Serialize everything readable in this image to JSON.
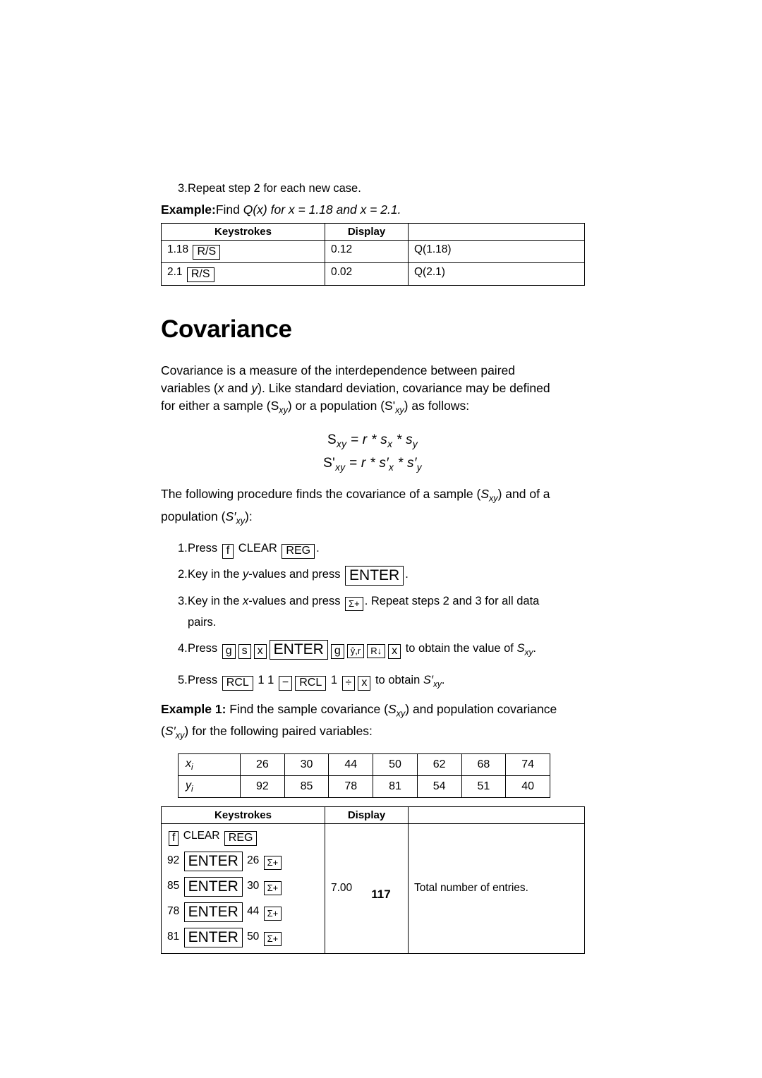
{
  "top_step": {
    "num": "3.",
    "text": "Repeat step 2 for each new case."
  },
  "example_q": {
    "label": "Example:",
    "text_1": "Find ",
    "q": "Q",
    "x1": "(x) for x = 1.18 and x = 2.1."
  },
  "table_q": {
    "headers": [
      "Keystrokes",
      "Display",
      ""
    ],
    "rows": [
      {
        "entry": "1.18",
        "key": "R/S",
        "display": "0.12",
        "note": "Q(1.18)"
      },
      {
        "entry": "2.1",
        "key": "R/S",
        "display": "0.02",
        "note": "Q(2.1)"
      }
    ]
  },
  "heading": "Covariance",
  "intro": {
    "l1": "Covariance is a measure of the interdependence between paired",
    "l2_a": "variables (",
    "l2_x": "x",
    "l2_b": " and ",
    "l2_y": "y",
    "l2_c": "). Like standard deviation, covariance may be defined",
    "l3_a": "for either a sample (S",
    "l3_sub1": "xy",
    "l3_b": ") or a population (S'",
    "l3_sub2": "xy",
    "l3_c": ") as follows:"
  },
  "formulas": {
    "f1": "S",
    "f1_sub": "xy",
    "f1_rest": " = r * s",
    "f1_sub2": "x",
    "f1_rest2": " * s",
    "f1_sub3": "y",
    "f2": "S'",
    "f2_sub": "xy",
    "f2_rest": " = r * s′",
    "f2_sub2": "x",
    "f2_rest2": " * s′",
    "f2_sub3": "y"
  },
  "procedure_intro": {
    "l1_a": "The following procedure finds the covariance of a sample (",
    "l1_s": "S",
    "l1_sub": "xy",
    "l1_b": ") and of a",
    "l2_a": "population (",
    "l2_s": "S′",
    "l2_sub": "xy",
    "l2_b": "):"
  },
  "steps": [
    {
      "num": "1.",
      "parts": [
        "Press ",
        "f",
        " CLEAR ",
        "REG",
        "."
      ]
    },
    {
      "num": "2.",
      "parts": [
        "Key in the ",
        "y",
        "-values and press ",
        "ENTER",
        "."
      ]
    },
    {
      "num": "3.",
      "parts": [
        "Key in the ",
        "x",
        "-values and press ",
        "Σ+",
        ". Repeat steps 2 and 3 for all data"
      ],
      "cont": "pairs."
    },
    {
      "num": "4.",
      "parts": [
        "Press ",
        "g",
        "s",
        "x",
        "ENTER",
        "g",
        "ŷ,r",
        "R↓",
        "x",
        " to obtain the value of "
      ],
      "tail_s": "S",
      "tail_sub": "xy",
      "tail_end": "."
    },
    {
      "num": "5.",
      "parts": [
        "Press ",
        "RCL",
        " 1 1 ",
        "−",
        "RCL",
        " 1 ",
        "÷",
        "x",
        " to obtain "
      ],
      "tail_s": "S′",
      "tail_sub": "xy",
      "tail_end": "."
    }
  ],
  "example1": {
    "label": "Example 1:",
    "l1": " Find the sample covariance (",
    "l1_s": "S",
    "l1_sub": "xy",
    "l1_b": ") and population covariance",
    "l2_a": "(",
    "l2_s": "S′",
    "l2_sub": "xy",
    "l2_b": ") for the following paired variables:"
  },
  "data_table": {
    "row_x_label": "x",
    "row_x_sub": "i",
    "row_y_label": "y",
    "row_y_sub": "i",
    "x_values": [
      "26",
      "30",
      "44",
      "50",
      "62",
      "68",
      "74"
    ],
    "y_values": [
      "92",
      "85",
      "78",
      "81",
      "54",
      "51",
      "40"
    ]
  },
  "table_ex1": {
    "headers": [
      "Keystrokes",
      "Display",
      ""
    ],
    "rows": [
      {
        "keys": "f CLEAR REG"
      },
      {
        "num": "92",
        "enter": "ENTER",
        "num2": "26",
        "sigma": "Σ+"
      },
      {
        "num": "85",
        "enter": "ENTER",
        "num2": "30",
        "sigma": "Σ+"
      },
      {
        "num": "78",
        "enter": "ENTER",
        "num2": "44",
        "sigma": "Σ+"
      },
      {
        "num": "81",
        "enter": "ENTER",
        "num2": "50",
        "sigma": "Σ+"
      }
    ],
    "display": "7.00",
    "note": "Total number of entries."
  },
  "keys": {
    "f": "f",
    "clear": "CLEAR",
    "reg": "REG",
    "enter": "ENTER",
    "sigma_plus": "Σ+",
    "g": "g",
    "s": "s",
    "x": "x",
    "yhat_r": "ŷ,r",
    "rdown": "R↓",
    "rcl": "RCL",
    "minus": "−",
    "divide": "÷",
    "rs": "R/S"
  },
  "page_number": "117"
}
